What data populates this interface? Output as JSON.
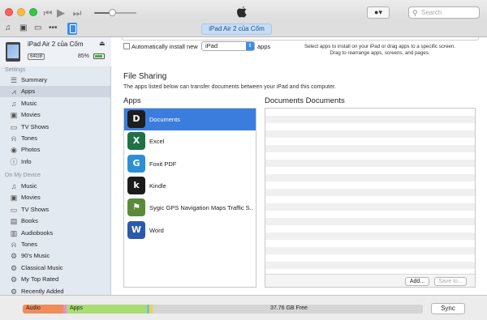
{
  "toolbar": {
    "search_placeholder": "Search",
    "device_pill": "iPad Air 2 của Cốm",
    "account_label": "●▾"
  },
  "device": {
    "name": "iPad Air 2 của Cốm",
    "capacity": "64GB",
    "battery_pct": "85%",
    "battery_level": 0.85
  },
  "sidebar": {
    "settings_header": "Settings",
    "settings_items": [
      {
        "label": "Summary",
        "icon": "summary-icon"
      },
      {
        "label": "Apps",
        "icon": "apps-icon"
      },
      {
        "label": "Music",
        "icon": "music-icon"
      },
      {
        "label": "Movies",
        "icon": "movies-icon"
      },
      {
        "label": "TV Shows",
        "icon": "tv-icon"
      },
      {
        "label": "Tones",
        "icon": "bell-icon"
      },
      {
        "label": "Photos",
        "icon": "camera-icon"
      },
      {
        "label": "Info",
        "icon": "info-icon"
      }
    ],
    "device_header": "On My Device",
    "device_items": [
      {
        "label": "Music",
        "icon": "music-icon"
      },
      {
        "label": "Movies",
        "icon": "movies-icon"
      },
      {
        "label": "TV Shows",
        "icon": "tv-icon"
      },
      {
        "label": "Books",
        "icon": "book-icon"
      },
      {
        "label": "Audiobooks",
        "icon": "audiobook-icon"
      },
      {
        "label": "Tones",
        "icon": "bell-icon"
      },
      {
        "label": "90's Music",
        "icon": "gear-icon"
      },
      {
        "label": "Classical Music",
        "icon": "gear-icon"
      },
      {
        "label": "My Top Rated",
        "icon": "gear-icon"
      },
      {
        "label": "Recently Added",
        "icon": "gear-icon"
      }
    ]
  },
  "main": {
    "auto_install_label": "Automatically install new",
    "auto_install_select": "iPad",
    "auto_install_suffix": "apps",
    "hint_line1": "Select apps to install on your iPad or drag apps to a specific screen.",
    "hint_line2": "Drag to rearrange apps, screens, and pages.",
    "file_sharing_title": "File Sharing",
    "file_sharing_sub": "The apps listed below can transfer documents between your iPad and this computer.",
    "apps_header": "Apps",
    "docs_header": "Documents Documents",
    "apps": [
      {
        "name": "Documents",
        "icon": "documents-app-icon",
        "color": "#1e1e1e",
        "glyph": "D"
      },
      {
        "name": "Excel",
        "icon": "excel-app-icon",
        "color": "#1f7245",
        "glyph": "X"
      },
      {
        "name": "Foxit PDF",
        "icon": "foxit-app-icon",
        "color": "#2c8fd6",
        "glyph": "G"
      },
      {
        "name": "Kindle",
        "icon": "kindle-app-icon",
        "color": "#1b1b1b",
        "glyph": "k"
      },
      {
        "name": "Sygic GPS Navigation Maps Traffic S...",
        "icon": "sygic-app-icon",
        "color": "#5b8b3a",
        "glyph": "⚑"
      },
      {
        "name": "Word",
        "icon": "word-app-icon",
        "color": "#2b5aa8",
        "glyph": "W"
      }
    ],
    "selected_app_index": 0,
    "add_button": "Add...",
    "save_button": "Save to..."
  },
  "capacity": {
    "audio_label": "Audio",
    "apps_label": "Apps",
    "free_label": "37.76 GB Free",
    "sync_button": "Sync",
    "colors": {
      "audio": "#f08c5a",
      "apps": "#a9dc74",
      "other": "#f0d14e",
      "free": "#d5d5d5"
    }
  }
}
